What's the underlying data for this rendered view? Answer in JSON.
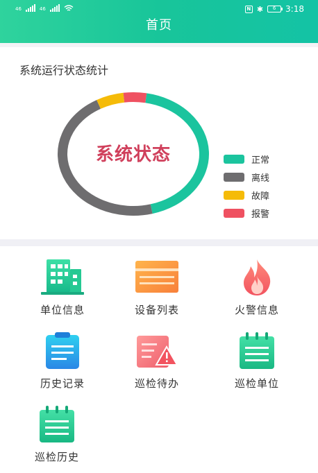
{
  "status_bar": {
    "left_tag_1": "46",
    "left_tag_2": "46",
    "time": "3:18",
    "battery": "6"
  },
  "header": {
    "title": "首页"
  },
  "stats": {
    "title": "系统运行状态统计",
    "center_text": "系统状态"
  },
  "chart_data": {
    "type": "pie",
    "title": "系统状态",
    "categories": [
      "正常",
      "离线",
      "故障",
      "报警"
    ],
    "values": [
      43,
      46,
      6,
      5
    ],
    "colors": [
      "#1bc49e",
      "#6e6d6f",
      "#f5bb08",
      "#ef5161"
    ],
    "legend_position": "right"
  },
  "menu": [
    {
      "label": "单位信息",
      "icon": "building-icon"
    },
    {
      "label": "设备列表",
      "icon": "list-icon"
    },
    {
      "label": "火警信息",
      "icon": "fire-icon"
    },
    {
      "label": "历史记录",
      "icon": "clipboard-icon"
    },
    {
      "label": "巡检待办",
      "icon": "todo-warning-icon"
    },
    {
      "label": "巡检单位",
      "icon": "notebook-icon"
    },
    {
      "label": "巡检历史",
      "icon": "notebook-icon"
    }
  ]
}
